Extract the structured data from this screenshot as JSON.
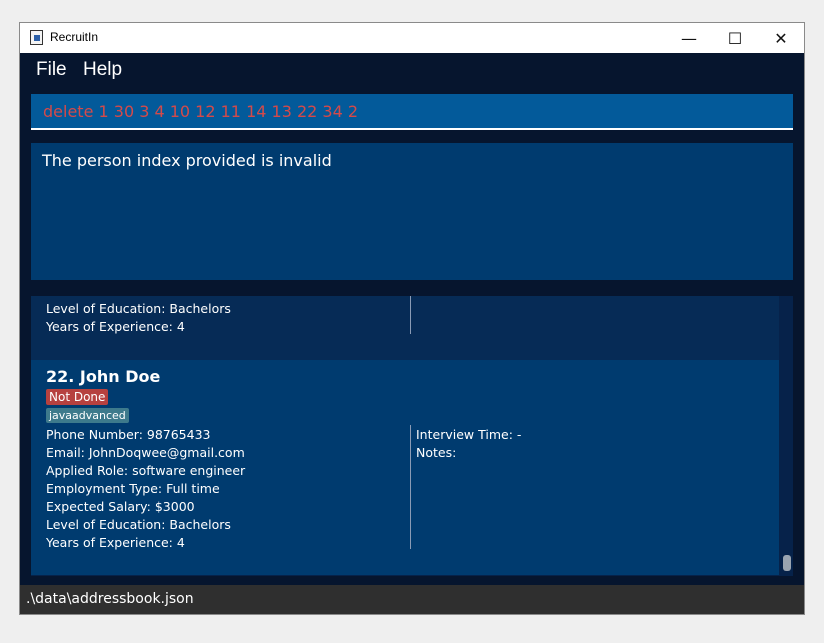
{
  "window": {
    "title": "RecruitIn",
    "minimize_label": "—",
    "maximize_label": "☐",
    "close_label": "✕"
  },
  "menu": {
    "file_label": "File",
    "help_label": "Help"
  },
  "command": {
    "value": "delete 1 30 3 4 10 12 11 14 13 22 34 2"
  },
  "result": {
    "message": "The person index provided is invalid"
  },
  "persons": {
    "previous": {
      "education": "Level of Education: Bachelors",
      "experience": "Years of Experience: 4"
    },
    "current": {
      "title": "22.  John Doe",
      "status": "Not Done",
      "tag": "javaadvanced",
      "phone": "Phone Number: 98765433",
      "email": "Email: JohnDoqwee@gmail.com",
      "role": "Applied Role: software engineer",
      "employment": "Employment Type: Full time",
      "salary": "Expected Salary: $3000",
      "education": "Level of Education: Bachelors",
      "experience": "Years of Experience: 4",
      "interview": "Interview Time: -",
      "notes": "Notes:"
    }
  },
  "status_bar": {
    "path": ".\\data\\addressbook.json"
  },
  "colors": {
    "background": "#06152e",
    "command_box": "#035a9a",
    "command_text": "#d44a4a",
    "card": "#003b6f",
    "status_badge": "#b6413f",
    "tag_badge": "#3d7a8c"
  }
}
